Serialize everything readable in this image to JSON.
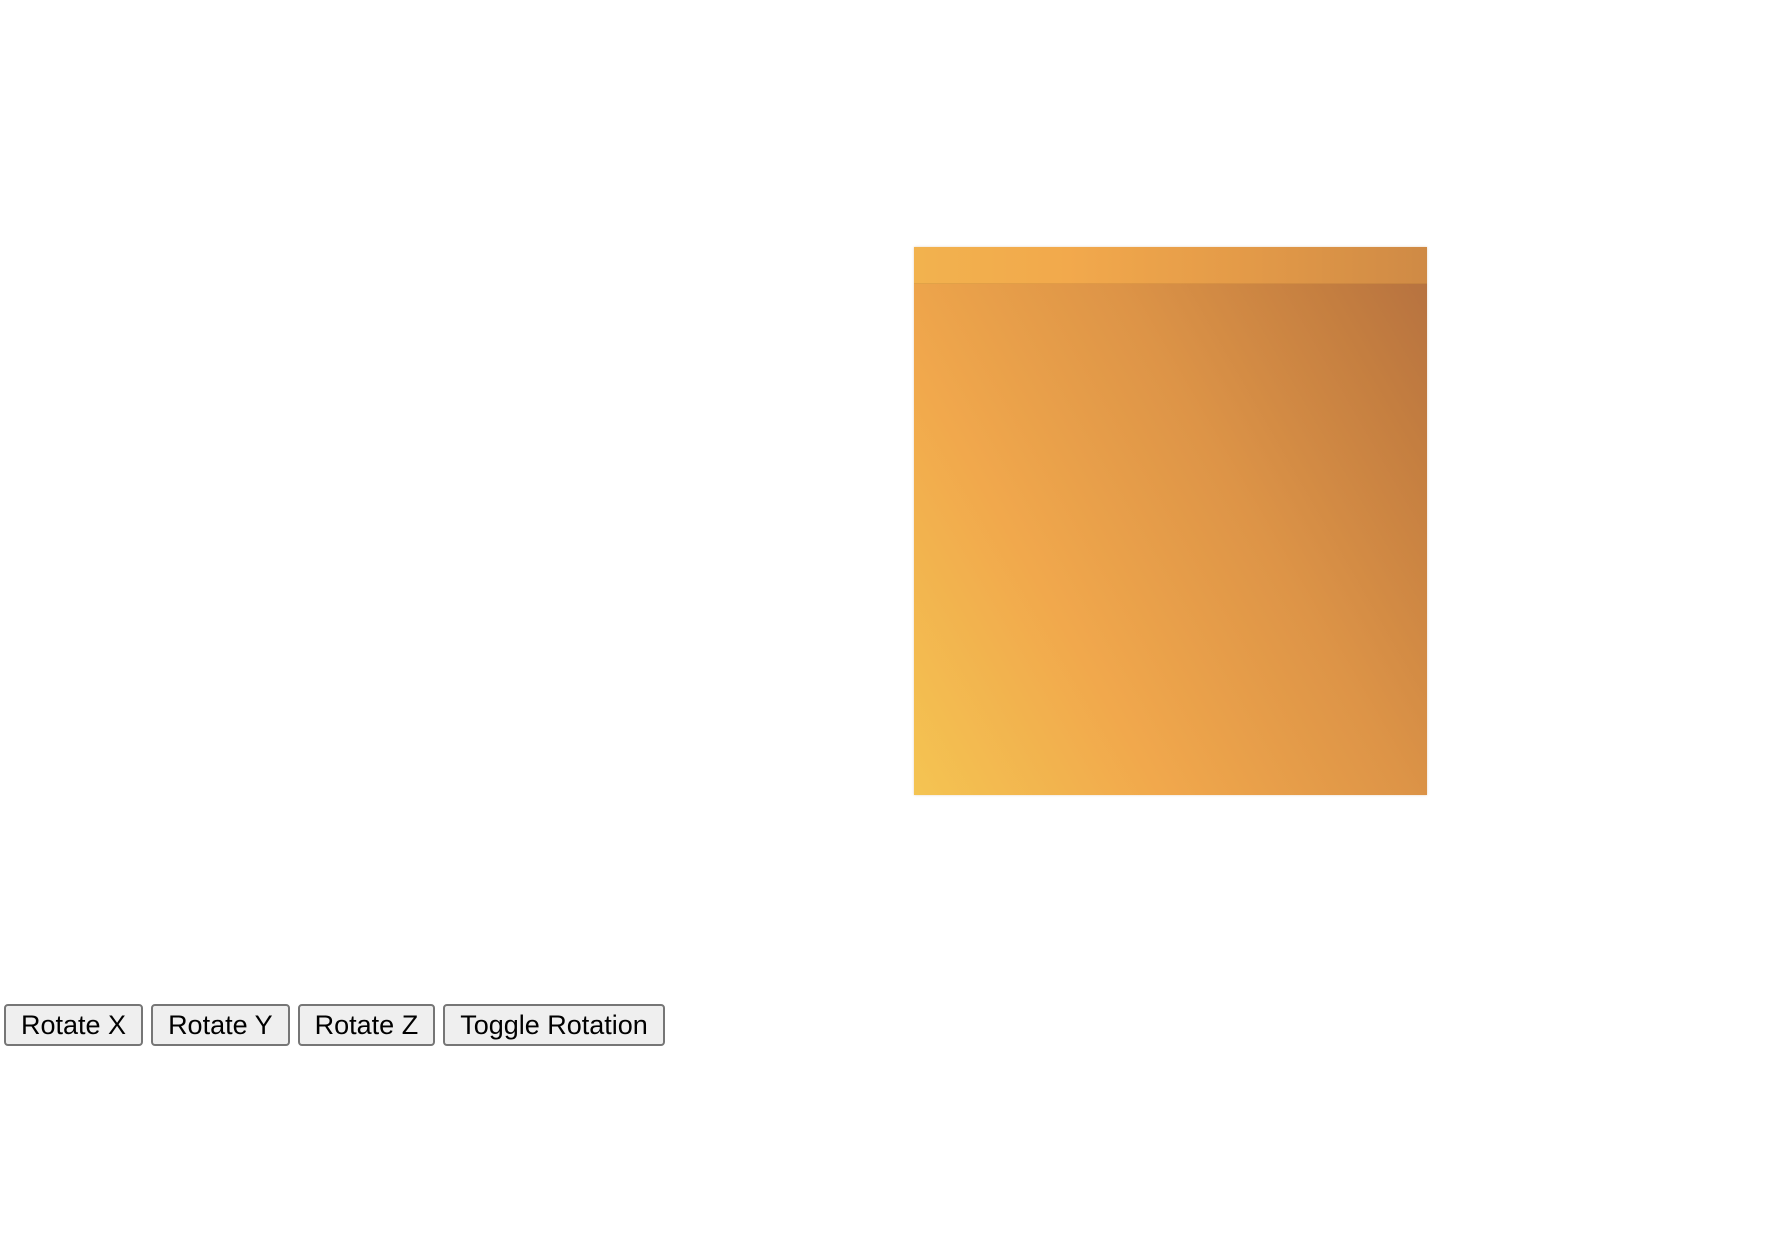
{
  "controls": {
    "rotate_x_label": "Rotate X",
    "rotate_y_label": "Rotate Y",
    "rotate_z_label": "Rotate Z",
    "toggle_rotation_label": "Toggle Rotation"
  },
  "cube": {
    "colors": {
      "light": "#f4c452",
      "mid": "#f1a84c",
      "dark": "#b47040"
    }
  }
}
